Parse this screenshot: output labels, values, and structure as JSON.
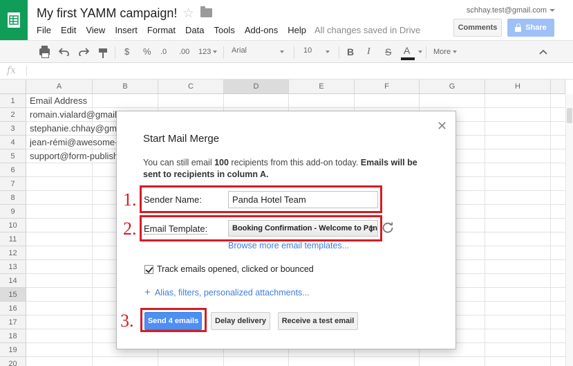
{
  "app": {
    "doc_title": "My first YAMM campaign!",
    "account": "schhay.test@gmail.com",
    "save_status": "All changes saved in Drive",
    "comments_label": "Comments",
    "share_label": "Share",
    "menu": [
      "File",
      "Edit",
      "View",
      "Insert",
      "Format",
      "Data",
      "Tools",
      "Add-ons",
      "Help"
    ]
  },
  "toolbar": {
    "currency": "$",
    "percent": "%",
    "decrease_decimals": ".0",
    "increase_decimals": ".00",
    "more_formats": "123",
    "font": "Arial",
    "font_size": "10",
    "bold": "B",
    "italic": "I",
    "strikethrough": "S",
    "text_color": "A",
    "more": "More",
    "text_color_value": "#222222"
  },
  "formula_bar": {
    "fx": "fx"
  },
  "sheet": {
    "columns": [
      "A",
      "B",
      "C",
      "D",
      "E",
      "F",
      "G",
      "H"
    ],
    "selected_column": "D",
    "selected_row": "15",
    "rows": [
      "1",
      "2",
      "3",
      "4",
      "5",
      "6",
      "7",
      "8",
      "9",
      "10",
      "11",
      "12",
      "13",
      "14",
      "15",
      "16",
      "17",
      "18",
      "19",
      "20"
    ],
    "cells": [
      "Email Address",
      "romain.vialard@gmail.c",
      "stephanie.chhay@gma",
      "jean-rémi@awesome-t",
      "support@form-publishe"
    ]
  },
  "dialog": {
    "title": "Start Mail Merge",
    "info_prefix": "You can still email ",
    "info_count": "100",
    "info_middle": " recipients from this add-on today. ",
    "info_bold": "Emails will be sent to recipients in column A.",
    "sender_label": "Sender Name:",
    "sender_value": "Panda Hotel Team",
    "template_label": "Email Template:",
    "template_value": "Booking Confirmation - Welcome to Panda Hotel",
    "browse_link": "Browse more email templates...",
    "track_label": "Track emails opened, clicked or bounced",
    "track_checked": true,
    "alias_link": "Alias, filters, personalized attachments...",
    "send_button": "Send 4 emails",
    "delay_button": "Delay delivery",
    "test_button": "Receive a test email",
    "step1": "1.",
    "step2": "2.",
    "step3": "3.",
    "highlight_color": "#d51c24",
    "primary_color": "#4d8ff2"
  }
}
